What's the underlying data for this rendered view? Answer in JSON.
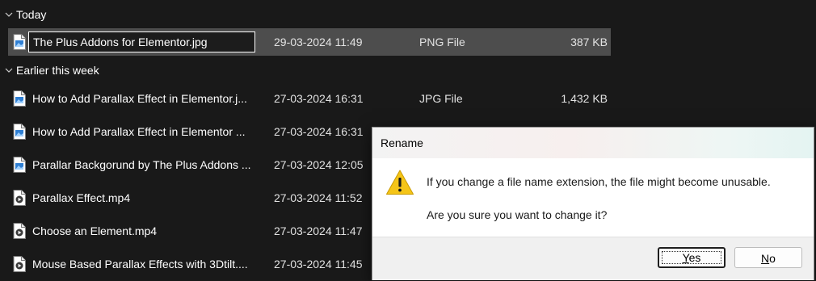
{
  "groups": [
    {
      "title": "Today",
      "icon": "chevron-down-icon"
    },
    {
      "title": "Earlier this week",
      "icon": "chevron-down-icon"
    }
  ],
  "rename": {
    "value": "The Plus Addons for Elementor.jpg",
    "date": "29-03-2024 11:49",
    "type": "PNG File",
    "size": "387 KB",
    "icon": "image-file-icon"
  },
  "files": [
    {
      "name": "How to Add Parallax Effect in Elementor.j...",
      "date": "27-03-2024 16:31",
      "type": "JPG File",
      "size": "1,432 KB",
      "icon": "image-file-icon"
    },
    {
      "name": "How to Add Parallax Effect in Elementor ...",
      "date": "27-03-2024 16:31",
      "type": "",
      "size": "",
      "icon": "image-file-icon"
    },
    {
      "name": "Parallar Backgorund by The Plus Addons ...",
      "date": "27-03-2024 12:05",
      "type": "",
      "size": "",
      "icon": "image-file-icon"
    },
    {
      "name": "Parallax Effect.mp4",
      "date": "27-03-2024 11:52",
      "type": "",
      "size": "",
      "icon": "video-file-icon"
    },
    {
      "name": "Choose an Element.mp4",
      "date": "27-03-2024 11:47",
      "type": "",
      "size": "",
      "icon": "video-file-icon"
    },
    {
      "name": "Mouse Based Parallax Effects with 3Dtilt....",
      "date": "27-03-2024 11:45",
      "type": "",
      "size": "",
      "icon": "video-file-icon"
    }
  ],
  "dialog": {
    "title": "Rename",
    "message": "If you change a file name extension, the file might become unusable.",
    "question": "Are you sure you want to change it?",
    "yes_mnemonic": "Y",
    "yes_rest": "es",
    "no_mnemonic": "N",
    "no_rest": "o",
    "warning_icon": "warning-icon"
  },
  "colors": {
    "background": "#191919",
    "selected_row": "#4d4d4d",
    "warning": "#f5c518"
  }
}
